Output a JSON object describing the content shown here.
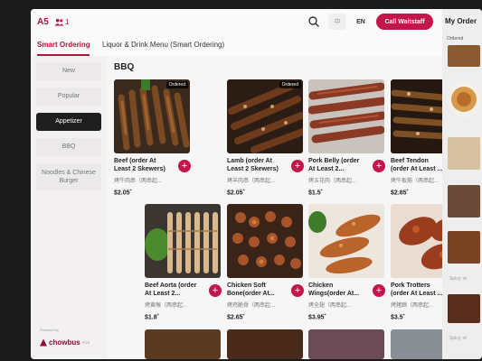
{
  "header": {
    "table": "A5",
    "guests": "1",
    "lang_zh": "中",
    "lang_en": "EN",
    "call_waitstaff": "Call Waitstaff"
  },
  "tabs": [
    {
      "label": "Smart Ordering",
      "active": true
    },
    {
      "label": "Liquor & Drink Menu (Smart Ordering)",
      "active": false
    }
  ],
  "sidebar": {
    "categories": [
      {
        "label": "New"
      },
      {
        "label": "Popular"
      },
      {
        "label": "Appetizer",
        "active": true
      },
      {
        "label": "BBQ"
      },
      {
        "label": "Noodles & Chinese Burger"
      }
    ],
    "powered_by": "Powered by",
    "brand": "chowbus",
    "brand_sub": "POS"
  },
  "main": {
    "section_title": "BBQ",
    "items": [
      {
        "name": "Beef (order At Least 2 Skewers)",
        "cn": "烤牛肉串（两串起...",
        "price": "$2.05",
        "ordered": "Ordered"
      },
      {
        "name": "Lamb (order At Least 2 Skewers)",
        "cn": "烤羊肉串（两串起...",
        "price": "$2.05",
        "ordered": "Ordered"
      },
      {
        "name": "Pork Belly (order At Least 2...",
        "cn": "烤五花肉（两串起...",
        "price": "$1.5"
      },
      {
        "name": "Beef Tendon (order At Least ...",
        "cn": "烤牛板筋（两串起...",
        "price": "$2.85"
      },
      {
        "name": "Beef Aorta (order At Least 2...",
        "cn": "烤黄喉（两串起...",
        "price": "$1.8"
      },
      {
        "name": "Chicken Soft Bone(order At...",
        "cn": "烤鸡脆骨（两串起...",
        "price": "$2.65"
      },
      {
        "name": "Chicken Wings(order At...",
        "cn": "烤全翅（两串起...",
        "price": "$3.95"
      },
      {
        "name": "Pork Trotters (order At Least ...",
        "cn": "烤猪蹄（两串起...",
        "price": "$3.5"
      }
    ],
    "add_label": "+"
  },
  "right_panel": {
    "title": "My Order",
    "ordered_label": "Ordered",
    "note_1": "Spicy: xl",
    "note_2": "Spicy: xl"
  }
}
